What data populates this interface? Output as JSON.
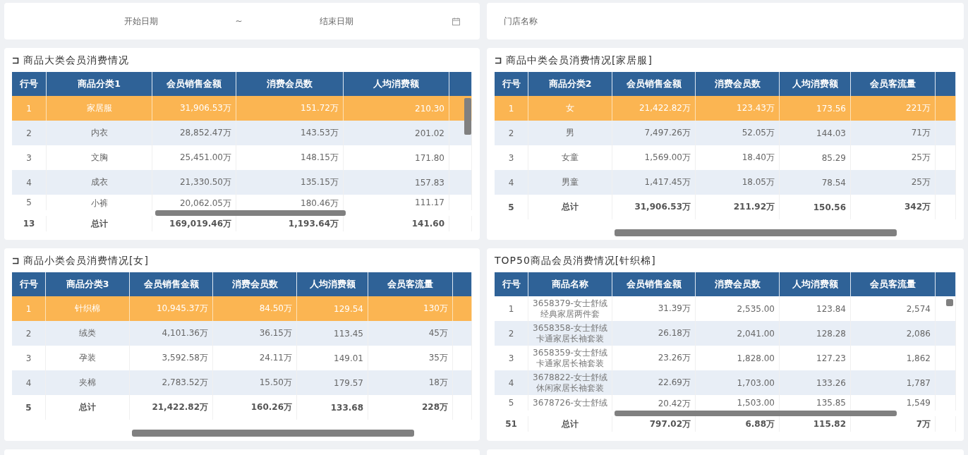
{
  "filters": {
    "start_date": {
      "placeholder": "开始日期"
    },
    "separator": "~",
    "end_date": {
      "placeholder": "结束日期"
    },
    "store": {
      "placeholder": "门店名称"
    }
  },
  "panels": [
    {
      "title": "商品大类会员消费情况",
      "icon": true,
      "columns": [
        "行号",
        "商品分类1",
        "会员销售金额",
        "消费会员数",
        "人均消费额"
      ],
      "rows": [
        {
          "selected": true,
          "cut": false,
          "cells": [
            "1",
            "家居服",
            "31,906.53万",
            "151.72万",
            "210.30"
          ]
        },
        {
          "selected": false,
          "cut": false,
          "cells": [
            "2",
            "内衣",
            "28,852.47万",
            "143.53万",
            "201.02"
          ]
        },
        {
          "selected": false,
          "cut": false,
          "cells": [
            "3",
            "文胸",
            "25,451.00万",
            "148.15万",
            "171.80"
          ]
        },
        {
          "selected": false,
          "cut": false,
          "cells": [
            "4",
            "成衣",
            "21,330.50万",
            "135.15万",
            "157.83"
          ]
        },
        {
          "selected": false,
          "cut": true,
          "cells": [
            "5",
            "小裤",
            "20,062.05万",
            "180.46万",
            "111.17"
          ]
        }
      ],
      "total": [
        "13",
        "总计",
        "169,019.46万",
        "1,193.64万",
        "141.60"
      ]
    },
    {
      "title": "商品中类会员消费情况[家居服]",
      "icon": true,
      "columns": [
        "行号",
        "商品分类2",
        "会员销售金额",
        "消费会员数",
        "人均消费额",
        "会员客流量"
      ],
      "rows": [
        {
          "selected": true,
          "cut": false,
          "cells": [
            "1",
            "女",
            "21,422.82万",
            "123.43万",
            "173.56",
            "221万"
          ]
        },
        {
          "selected": false,
          "cut": false,
          "cells": [
            "2",
            "男",
            "7,497.26万",
            "52.05万",
            "144.03",
            "71万"
          ]
        },
        {
          "selected": false,
          "cut": false,
          "cells": [
            "3",
            "女童",
            "1,569.00万",
            "18.40万",
            "85.29",
            "25万"
          ]
        },
        {
          "selected": false,
          "cut": false,
          "cells": [
            "4",
            "男童",
            "1,417.45万",
            "18.05万",
            "78.54",
            "25万"
          ]
        }
      ],
      "total": [
        "5",
        "总计",
        "31,906.53万",
        "211.92万",
        "150.56",
        "342万"
      ]
    },
    {
      "title": "商品小类会员消费情况[女]",
      "icon": true,
      "columns": [
        "行号",
        "商品分类3",
        "会员销售金额",
        "消费会员数",
        "人均消费额",
        "会员客流量"
      ],
      "rows": [
        {
          "selected": true,
          "cut": false,
          "cells": [
            "1",
            "针织棉",
            "10,945.37万",
            "84.50万",
            "129.54",
            "130万"
          ]
        },
        {
          "selected": false,
          "cut": false,
          "cells": [
            "2",
            "绒类",
            "4,101.36万",
            "36.15万",
            "113.45",
            "45万"
          ]
        },
        {
          "selected": false,
          "cut": false,
          "cells": [
            "3",
            "孕装",
            "3,592.58万",
            "24.11万",
            "149.01",
            "35万"
          ]
        },
        {
          "selected": false,
          "cut": false,
          "cells": [
            "4",
            "夹棉",
            "2,783.52万",
            "15.50万",
            "179.57",
            "18万"
          ]
        }
      ],
      "total": [
        "5",
        "总计",
        "21,422.82万",
        "160.26万",
        "133.68",
        "228万"
      ]
    },
    {
      "title": "TOP50商品会员消费情况[针织棉]",
      "icon": false,
      "columns": [
        "行号",
        "商品名称",
        "会员销售金额",
        "消费会员数",
        "人均消费额",
        "会员客流量"
      ],
      "rows": [
        {
          "selected": false,
          "cut": false,
          "cells": [
            "1",
            [
              "3658379-女士舒绒",
              "经典家居两件套"
            ],
            "31.39万",
            "2,535.00",
            "123.84",
            "2,574"
          ]
        },
        {
          "selected": false,
          "cut": false,
          "cells": [
            "2",
            [
              "3658358-女士舒绒",
              "卡通家居长袖套装"
            ],
            "26.18万",
            "2,041.00",
            "128.28",
            "2,086"
          ]
        },
        {
          "selected": false,
          "cut": false,
          "cells": [
            "3",
            [
              "3658359-女士舒绒",
              "卡通家居长袖套装"
            ],
            "23.26万",
            "1,828.00",
            "127.23",
            "1,862"
          ]
        },
        {
          "selected": false,
          "cut": false,
          "cells": [
            "4",
            [
              "3678822-女士舒绒",
              "休闲家居长袖套装"
            ],
            "22.69万",
            "1,703.00",
            "133.26",
            "1,787"
          ]
        },
        {
          "selected": false,
          "cut": true,
          "cells": [
            "5",
            [
              "3678726-女士舒绒"
            ],
            "20.42万",
            "1,503.00",
            "135.85",
            "1,549"
          ]
        }
      ],
      "total": [
        "51",
        "总计",
        "797.02万",
        "6.88万",
        "115.82",
        "7万"
      ]
    }
  ]
}
